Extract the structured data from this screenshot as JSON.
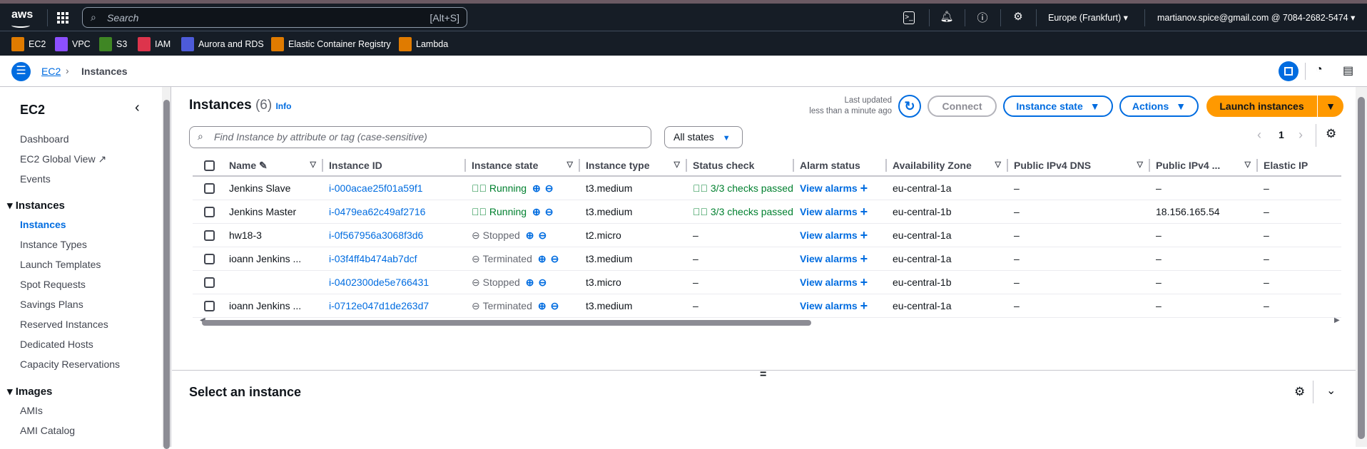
{
  "nav": {
    "logo": "aws",
    "search_placeholder": "Search",
    "search_shortcut": "[Alt+S]",
    "region": "Europe (Frankfurt)",
    "account": "martianov.spice@gmail.com @ 7084-2682-5474"
  },
  "favorites": [
    {
      "label": "EC2",
      "color": "#e07b00"
    },
    {
      "label": "VPC",
      "color": "#8c4fff"
    },
    {
      "label": "S3",
      "color": "#3f8624"
    },
    {
      "label": "IAM",
      "color": "#dd344c"
    },
    {
      "label": "Aurora and RDS",
      "color": "#4d5bd9"
    },
    {
      "label": "Elastic Container Registry",
      "color": "#e07b00"
    },
    {
      "label": "Lambda",
      "color": "#e07b00"
    }
  ],
  "breadcrumb": {
    "root": "EC2",
    "current": "Instances"
  },
  "sidebar": {
    "title": "EC2",
    "items": [
      "Dashboard",
      "EC2 Global View",
      "Events"
    ],
    "sections": [
      {
        "title": "Instances",
        "items": [
          "Instances",
          "Instance Types",
          "Launch Templates",
          "Spot Requests",
          "Savings Plans",
          "Reserved Instances",
          "Dedicated Hosts",
          "Capacity Reservations"
        ]
      },
      {
        "title": "Images",
        "items": [
          "AMIs",
          "AMI Catalog"
        ]
      }
    ]
  },
  "main": {
    "title": "Instances",
    "count": "(6)",
    "info": "Info",
    "last_updated_1": "Last updated",
    "last_updated_2": "less than a minute ago",
    "connect": "Connect",
    "instance_state": "Instance state",
    "actions": "Actions",
    "launch": "Launch instances",
    "filter_placeholder": "Find Instance by attribute or tag (case-sensitive)",
    "states_filter": "All states",
    "page": "1",
    "columns": [
      "Name",
      "Instance ID",
      "Instance state",
      "Instance type",
      "Status check",
      "Alarm status",
      "Availability Zone",
      "Public IPv4 DNS",
      "Public IPv4 ...",
      "Elastic IP"
    ],
    "rows": [
      {
        "name": "Jenkins Slave",
        "id": "i-000acae25f01a59f1",
        "state": "Running",
        "type": "t3.medium",
        "status": "3/3 checks passed",
        "alarm": "View alarms",
        "az": "eu-central-1a",
        "dns": "–",
        "ipv4": "–",
        "eip": "–"
      },
      {
        "name": "Jenkins Master",
        "id": "i-0479ea62c49af2716",
        "state": "Running",
        "type": "t3.medium",
        "status": "3/3 checks passed",
        "alarm": "View alarms",
        "az": "eu-central-1b",
        "dns": "–",
        "ipv4": "18.156.165.54",
        "eip": "–"
      },
      {
        "name": "hw18-3",
        "id": "i-0f567956a3068f3d6",
        "state": "Stopped",
        "type": "t2.micro",
        "status": "–",
        "alarm": "View alarms",
        "az": "eu-central-1a",
        "dns": "–",
        "ipv4": "–",
        "eip": "–"
      },
      {
        "name": "ioann Jenkins ...",
        "id": "i-03f4ff4b474ab7dcf",
        "state": "Terminated",
        "type": "t3.medium",
        "status": "–",
        "alarm": "View alarms",
        "az": "eu-central-1a",
        "dns": "–",
        "ipv4": "–",
        "eip": "–"
      },
      {
        "name": "",
        "id": "i-0402300de5e766431",
        "state": "Stopped",
        "type": "t3.micro",
        "status": "–",
        "alarm": "View alarms",
        "az": "eu-central-1b",
        "dns": "–",
        "ipv4": "–",
        "eip": "–"
      },
      {
        "name": "ioann Jenkins ...",
        "id": "i-0712e047d1de263d7",
        "state": "Terminated",
        "type": "t3.medium",
        "status": "–",
        "alarm": "View alarms",
        "az": "eu-central-1a",
        "dns": "–",
        "ipv4": "–",
        "eip": "–"
      }
    ],
    "details_title": "Select an instance",
    "divider": "="
  }
}
